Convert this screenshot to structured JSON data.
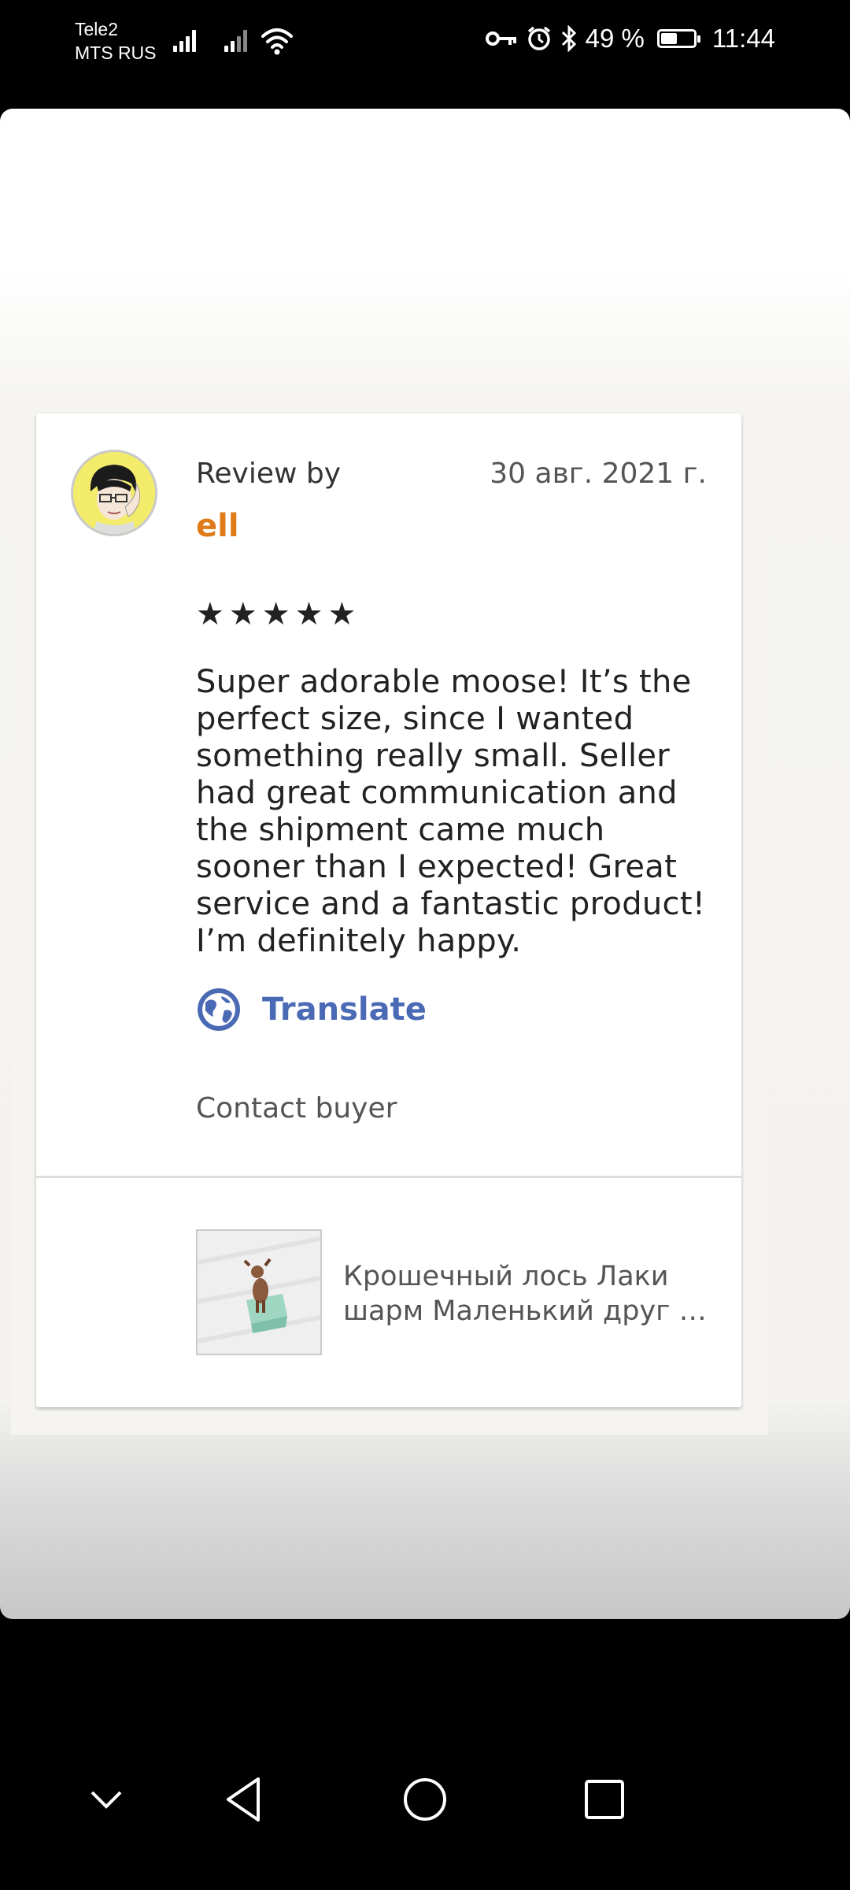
{
  "status_bar": {
    "carrier1": "Tele2",
    "carrier2": "MTS RUS",
    "battery": "49 %",
    "battery_level": 0.49,
    "time": "11:44"
  },
  "review": {
    "review_by_label": "Review by",
    "reviewer": "ell",
    "date": "30 авг. 2021 г.",
    "stars": "★★★★★",
    "rating": 5,
    "text": "Super adorable moose! It’s the perfect size, since I wanted something really small. Seller had great communication and the shipment came much sooner than I expected! Great service and a fantastic product! I’m definitely happy.",
    "translate_label": "Translate",
    "contact_label": "Contact buyer"
  },
  "listing": {
    "title_line1": "Крошечный лось Лаки",
    "title_line2": "шарм Маленький друг д..."
  },
  "icons": {
    "key": "key-icon",
    "alarm": "alarm-icon",
    "bluetooth": "bluetooth-icon",
    "translate": "globe-icon",
    "back": "back-icon",
    "home": "home-icon",
    "recents": "recents-icon",
    "collapse": "chevron-down-icon"
  },
  "colors": {
    "reviewer": "#e07b1a",
    "translate": "#4b6ab5"
  }
}
